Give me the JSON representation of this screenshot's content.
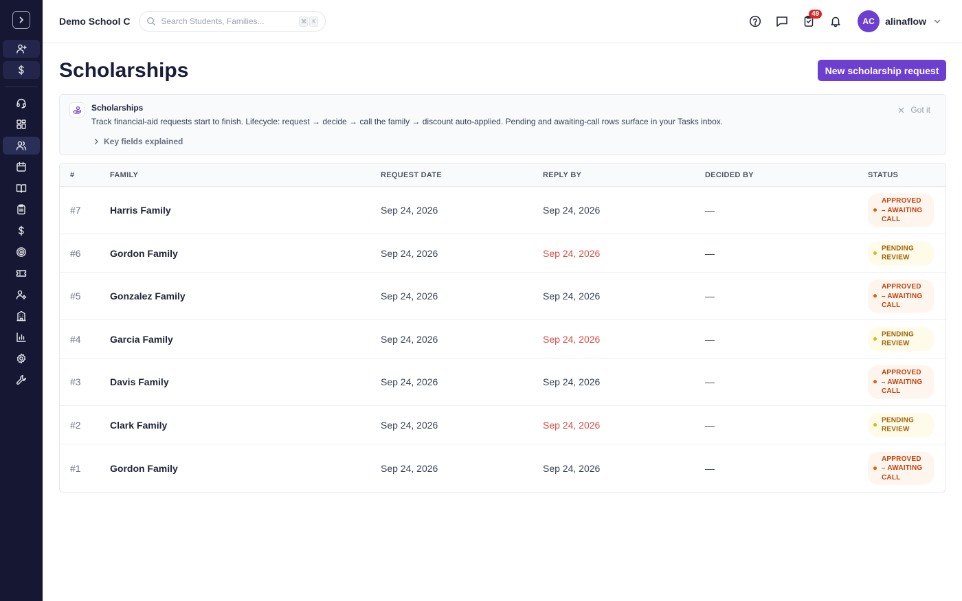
{
  "header": {
    "school_name": "Demo School C",
    "search_placeholder": "Search Students, Families...",
    "kbd_1": "⌘",
    "kbd_2": "K",
    "tasks_badge": "49",
    "user": {
      "initials": "AC",
      "name": "alinaflow"
    }
  },
  "page": {
    "title": "Scholarships",
    "new_button": "New scholarship request"
  },
  "info": {
    "title": "Scholarships",
    "text": "Track financial-aid requests start to finish. Lifecycle: request → decide → call the family → discount auto-applied. Pending and awaiting-call rows surface in your Tasks inbox.",
    "dismiss": "Got it",
    "expand": "Key fields explained"
  },
  "table": {
    "columns": [
      "#",
      "FAMILY",
      "REQUEST DATE",
      "REPLY BY",
      "DECIDED BY",
      "STATUS"
    ],
    "rows": [
      {
        "num": "#7",
        "family": "Harris Family",
        "request_date": "Sep 24, 2026",
        "reply_by": "Sep 24, 2026",
        "decided_by": "—",
        "status": "APPROVED – AWAITING CALL"
      },
      {
        "num": "#6",
        "family": "Gordon Family",
        "request_date": "Sep 24, 2026",
        "reply_by": "Sep 24, 2026",
        "decided_by": "—",
        "status": "PENDING REVIEW"
      },
      {
        "num": "#5",
        "family": "Gonzalez Family",
        "request_date": "Sep 24, 2026",
        "reply_by": "Sep 24, 2026",
        "decided_by": "—",
        "status": "APPROVED – AWAITING CALL"
      },
      {
        "num": "#4",
        "family": "Garcia Family",
        "request_date": "Sep 24, 2026",
        "reply_by": "Sep 24, 2026",
        "decided_by": "—",
        "status": "PENDING REVIEW"
      },
      {
        "num": "#3",
        "family": "Davis Family",
        "request_date": "Sep 24, 2026",
        "reply_by": "Sep 24, 2026",
        "decided_by": "—",
        "status": "APPROVED – AWAITING CALL"
      },
      {
        "num": "#2",
        "family": "Clark Family",
        "request_date": "Sep 24, 2026",
        "reply_by": "Sep 24, 2026",
        "decided_by": "—",
        "status": "PENDING REVIEW"
      },
      {
        "num": "#1",
        "family": "Gordon Family",
        "request_date": "Sep 24, 2026",
        "reply_by": "Sep 24, 2026",
        "decided_by": "—",
        "status": "APPROVED – AWAITING CALL"
      }
    ]
  },
  "colors": {
    "sidebar_bg": "#151733",
    "accent": "#6d3fd0",
    "overdue": "#dc4b3f",
    "approved_text": "#c2410c",
    "pending_text": "#a16207"
  }
}
